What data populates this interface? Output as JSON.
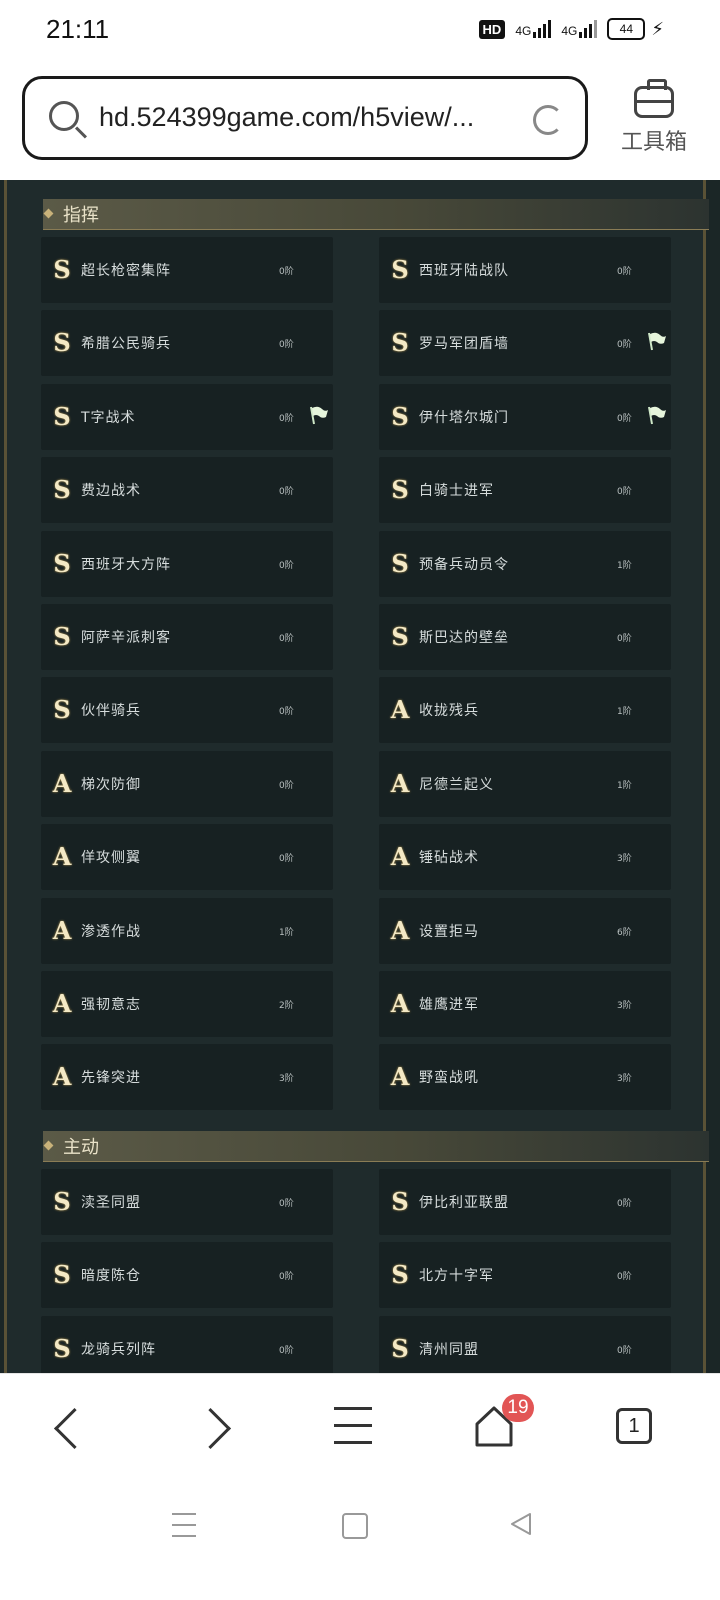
{
  "status_bar": {
    "time": "21:11",
    "hd": "HD",
    "net1": "4G",
    "net2": "4G",
    "battery": "44"
  },
  "browser": {
    "url": "hd.524399game.com/h5view/...",
    "toolbox_label": "工具箱",
    "tab_count": "1",
    "home_badge": "19"
  },
  "sections": [
    {
      "title": "指挥",
      "items": [
        {
          "grade": "S",
          "name": "超长枪密集阵",
          "level": "0阶",
          "flag": false
        },
        {
          "grade": "S",
          "name": "西班牙陆战队",
          "level": "0阶",
          "flag": false
        },
        {
          "grade": "S",
          "name": "希腊公民骑兵",
          "level": "0阶",
          "flag": false
        },
        {
          "grade": "S",
          "name": "罗马军团盾墙",
          "level": "0阶",
          "flag": true
        },
        {
          "grade": "S",
          "name": "T字战术",
          "level": "0阶",
          "flag": true
        },
        {
          "grade": "S",
          "name": "伊什塔尔城门",
          "level": "0阶",
          "flag": true
        },
        {
          "grade": "S",
          "name": "费边战术",
          "level": "0阶",
          "flag": false
        },
        {
          "grade": "S",
          "name": "白骑士进军",
          "level": "0阶",
          "flag": false
        },
        {
          "grade": "S",
          "name": "西班牙大方阵",
          "level": "0阶",
          "flag": false
        },
        {
          "grade": "S",
          "name": "预备兵动员令",
          "level": "1阶",
          "flag": false
        },
        {
          "grade": "S",
          "name": "阿萨辛派刺客",
          "level": "0阶",
          "flag": false
        },
        {
          "grade": "S",
          "name": "斯巴达的壁垒",
          "level": "0阶",
          "flag": false
        },
        {
          "grade": "S",
          "name": "伙伴骑兵",
          "level": "0阶",
          "flag": false
        },
        {
          "grade": "A",
          "name": "收拢残兵",
          "level": "1阶",
          "flag": false
        },
        {
          "grade": "A",
          "name": "梯次防御",
          "level": "0阶",
          "flag": false
        },
        {
          "grade": "A",
          "name": "尼德兰起义",
          "level": "1阶",
          "flag": false
        },
        {
          "grade": "A",
          "name": "佯攻侧翼",
          "level": "0阶",
          "flag": false
        },
        {
          "grade": "A",
          "name": "锤砧战术",
          "level": "3阶",
          "flag": false
        },
        {
          "grade": "A",
          "name": "渗透作战",
          "level": "1阶",
          "flag": false
        },
        {
          "grade": "A",
          "name": "设置拒马",
          "level": "6阶",
          "flag": false
        },
        {
          "grade": "A",
          "name": "强韧意志",
          "level": "2阶",
          "flag": false
        },
        {
          "grade": "A",
          "name": "雄鹰进军",
          "level": "3阶",
          "flag": false
        },
        {
          "grade": "A",
          "name": "先锋突进",
          "level": "3阶",
          "flag": false
        },
        {
          "grade": "A",
          "name": "野蛮战吼",
          "level": "3阶",
          "flag": false
        }
      ]
    },
    {
      "title": "主动",
      "items": [
        {
          "grade": "S",
          "name": "渎圣同盟",
          "level": "0阶",
          "flag": false
        },
        {
          "grade": "S",
          "name": "伊比利亚联盟",
          "level": "0阶",
          "flag": false
        },
        {
          "grade": "S",
          "name": "暗度陈仓",
          "level": "0阶",
          "flag": false
        },
        {
          "grade": "S",
          "name": "北方十字军",
          "level": "0阶",
          "flag": false
        },
        {
          "grade": "S",
          "name": "龙骑兵列阵",
          "level": "0阶",
          "flag": false
        },
        {
          "grade": "S",
          "name": "清州同盟",
          "level": "0阶",
          "flag": false
        }
      ]
    }
  ],
  "icons": {
    "search": "search-icon",
    "reload": "reload-icon",
    "toolbox": "toolbox-icon",
    "flag": "flag-icon",
    "back": "chevron-left-icon",
    "forward": "chevron-right-icon",
    "menu": "menu-icon",
    "home": "home-icon",
    "tabs": "tabs-icon"
  }
}
